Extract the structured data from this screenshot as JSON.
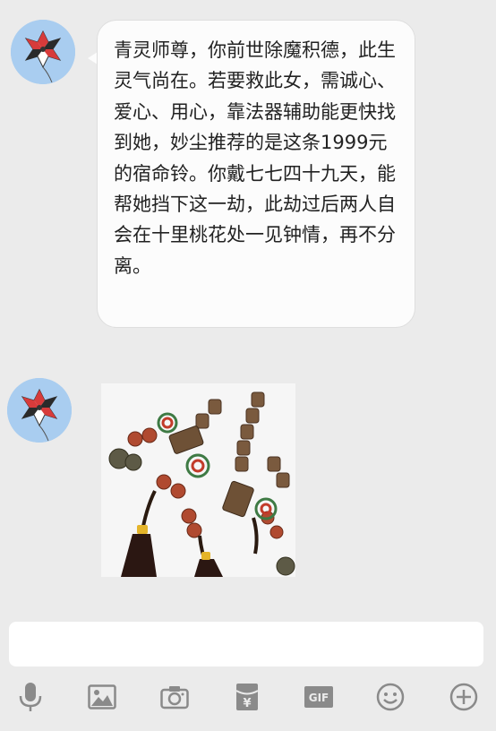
{
  "messages": [
    {
      "type": "text",
      "sender_avatar": "kite-icon",
      "text": "青灵师尊，你前世除魔积德，此生灵气尚在。若要救此女，需诚心、爱心、用心，靠法器辅助能更快找到她，妙尘推荐的是这条1999元的宿命铃。你戴七七四十九天，能帮她挡下这一劫，此劫过后两人自会在十里桃花处一见钟情，再不分离。"
    },
    {
      "type": "image",
      "sender_avatar": "kite-icon",
      "image_subject": "prayer-bead-bracelets-with-tassels"
    }
  ],
  "input": {
    "value": "",
    "placeholder": ""
  },
  "toolbar": [
    {
      "icon": "microphone-icon"
    },
    {
      "icon": "image-icon"
    },
    {
      "icon": "camera-icon"
    },
    {
      "icon": "red-packet-icon"
    },
    {
      "icon": "gif-icon"
    },
    {
      "icon": "emoji-icon"
    },
    {
      "icon": "plus-icon"
    }
  ],
  "colors": {
    "background": "#ebebeb",
    "bubble": "#fcfcfc",
    "avatar_bg": "#a9cdf0",
    "icon_gray": "#8a8a8a"
  }
}
